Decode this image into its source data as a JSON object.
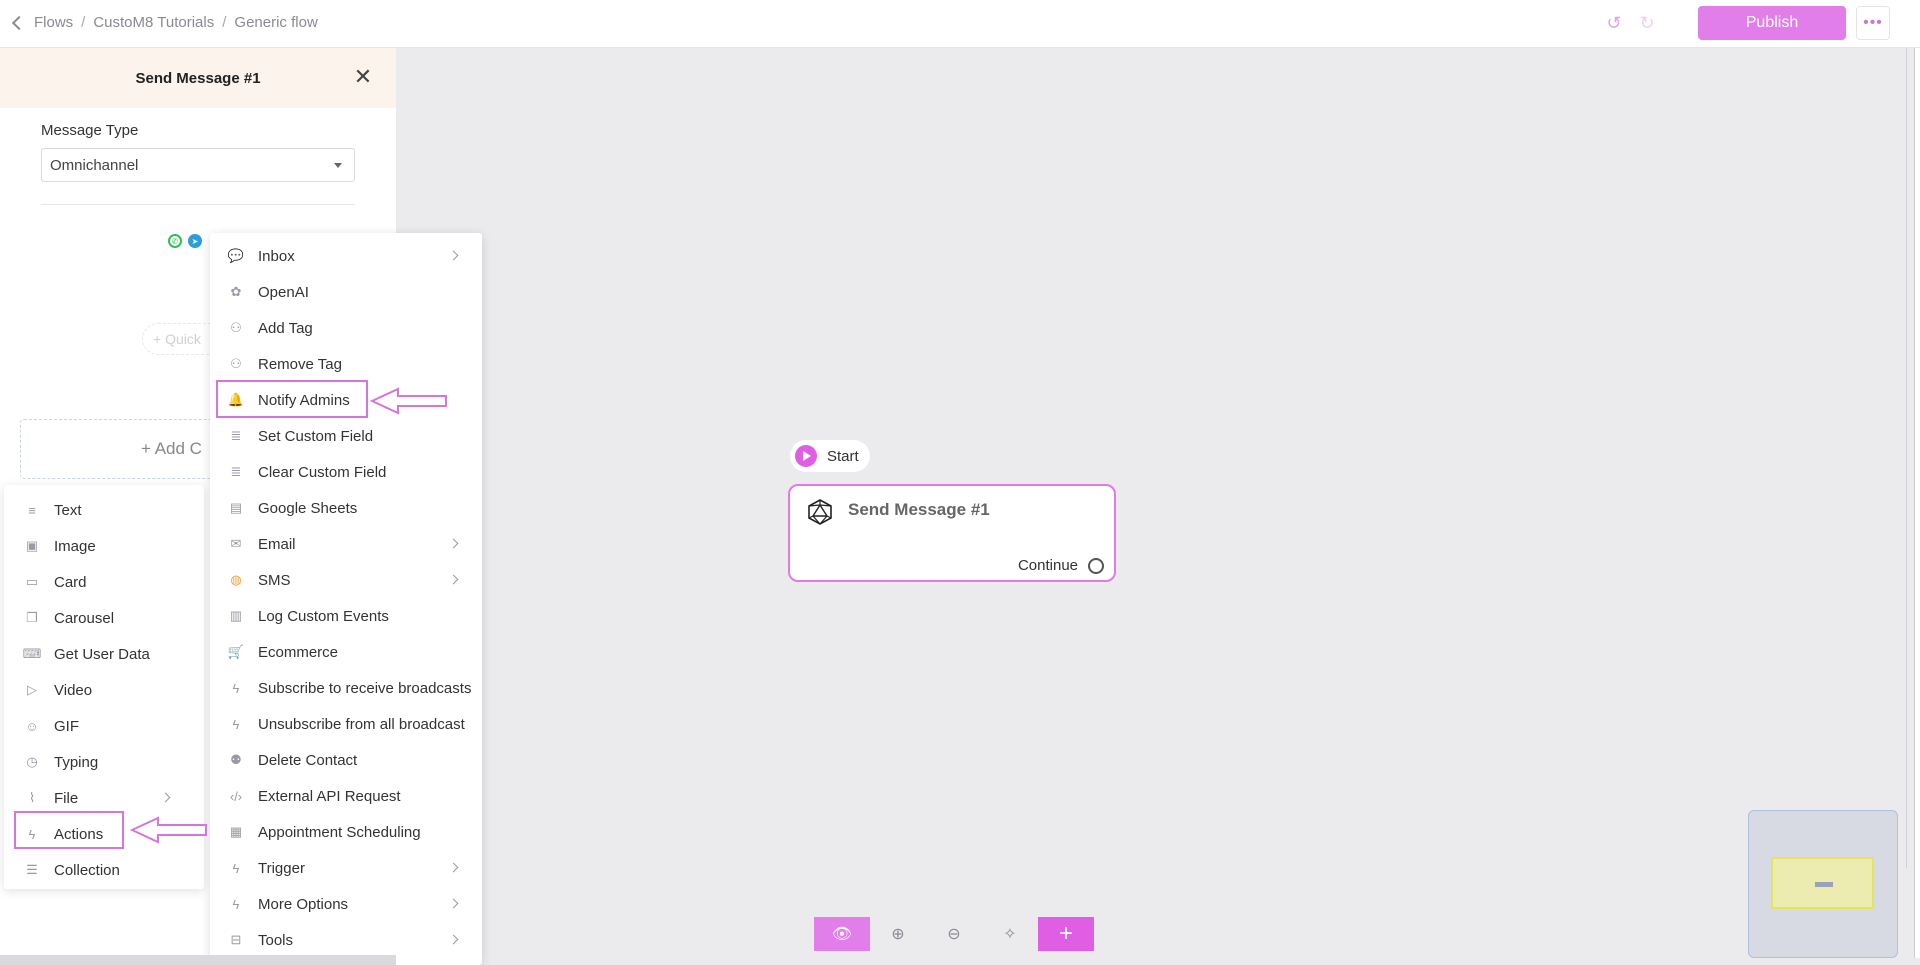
{
  "breadcrumb": {
    "items": [
      "Flows",
      "CustoM8 Tutorials",
      "Generic flow"
    ]
  },
  "topbar": {
    "publish_label": "Publish"
  },
  "panel": {
    "title": "Send Message #1",
    "message_type_label": "Message Type",
    "message_type_value": "Omnichannel",
    "quick_reply_label": "+ Quick",
    "add_content_label": "+ Add C"
  },
  "menu_left": {
    "items": [
      {
        "label": "Text",
        "icon": "text-lines-icon"
      },
      {
        "label": "Image",
        "icon": "image-icon"
      },
      {
        "label": "Card",
        "icon": "card-icon"
      },
      {
        "label": "Carousel",
        "icon": "carousel-icon"
      },
      {
        "label": "Get User Data",
        "icon": "keyboard-icon"
      },
      {
        "label": "Video",
        "icon": "video-icon"
      },
      {
        "label": "GIF",
        "icon": "gif-icon"
      },
      {
        "label": "Typing",
        "icon": "clock-icon"
      },
      {
        "label": "File",
        "icon": "paperclip-icon"
      },
      {
        "label": "Actions",
        "icon": "bolt-icon"
      },
      {
        "label": "Collection",
        "icon": "list-icon"
      }
    ]
  },
  "menu_right": {
    "items": [
      {
        "label": "Inbox",
        "icon": "chat-icon"
      },
      {
        "label": "OpenAI",
        "icon": "openai-icon"
      },
      {
        "label": "Add Tag",
        "icon": "user-tag-icon"
      },
      {
        "label": "Remove Tag",
        "icon": "user-tag-icon"
      },
      {
        "label": "Notify Admins",
        "icon": "bell-icon"
      },
      {
        "label": "Set Custom Field",
        "icon": "database-icon"
      },
      {
        "label": "Clear Custom Field",
        "icon": "database-icon"
      },
      {
        "label": "Google Sheets",
        "icon": "sheet-icon"
      },
      {
        "label": "Email",
        "icon": "email-icon"
      },
      {
        "label": "SMS",
        "icon": "sms-icon"
      },
      {
        "label": "Log Custom Events",
        "icon": "chart-icon"
      },
      {
        "label": "Ecommerce",
        "icon": "cart-icon"
      },
      {
        "label": "Subscribe to receive broadcasts",
        "icon": "bolt-icon"
      },
      {
        "label": "Unsubscribe from all broadcast",
        "icon": "bolt-icon"
      },
      {
        "label": "Delete Contact",
        "icon": "user-x-icon"
      },
      {
        "label": "External API Request",
        "icon": "code-icon"
      },
      {
        "label": "Appointment Scheduling",
        "icon": "calendar-icon"
      },
      {
        "label": "Trigger",
        "icon": "bolt-icon"
      },
      {
        "label": "More Options",
        "icon": "bolt-icon"
      },
      {
        "label": "Tools",
        "icon": "toolbox-icon"
      }
    ]
  },
  "canvas": {
    "start_label": "Start",
    "node_title": "Send Message #1",
    "node_continue": "Continue"
  },
  "colors": {
    "accent": "#e27ee9",
    "highlight": "#d675dd",
    "start": "#df5ee4"
  }
}
